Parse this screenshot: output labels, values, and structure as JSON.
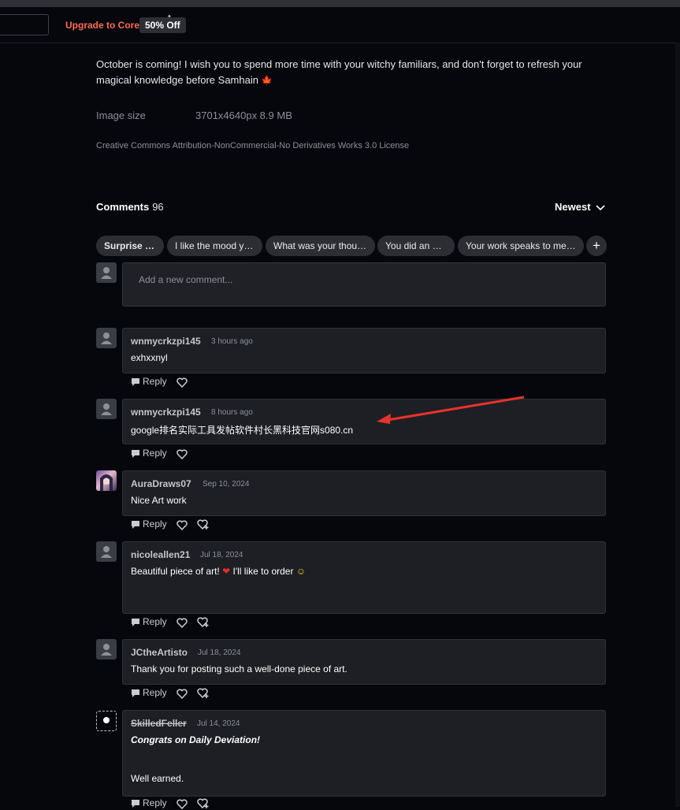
{
  "header": {
    "upgrade_link": "Upgrade to Core",
    "discount_badge": "50% Off"
  },
  "description": {
    "text": "October is coming! I wish you to spend more time with your witchy familiars, and don't forget to refresh your magical knowledge before Samhain",
    "icon": "maple-leaf-icon"
  },
  "image_meta": {
    "label": "Image size",
    "value": "3701x4640px 8.9 MB",
    "license": "Creative Commons Attribution-NonCommercial-No Derivatives Works 3.0 License"
  },
  "comments": {
    "title": "Comments",
    "count": "96",
    "sort_label": "Newest",
    "suggestions": [
      "Surprise Me!",
      "I like the mood y…",
      "What was your thou…",
      "You did an a…",
      "Your work speaks to me …"
    ],
    "new_comment_placeholder": "Add a new comment...",
    "reply_label": "Reply",
    "items": [
      {
        "user": "wnmycrkzpi145",
        "time": "3 hours ago",
        "lines": [
          "exhxxnyl"
        ]
      },
      {
        "user": "wnmycrkzpi145",
        "time": "8 hours ago",
        "lines": [
          "google排名实际工具发帖软件村长黑科技官网s080.cn"
        ]
      },
      {
        "user": "AuraDraws07",
        "time": "Sep 10, 2024",
        "lines": [
          "Nice Art work"
        ]
      },
      {
        "user": "nicoleallen21",
        "time": "Jul 18, 2024",
        "lines": [
          "Beautiful piece of art!",
          "I'll like to order"
        ]
      },
      {
        "user": "JCtheArtisto",
        "time": "Jul 18, 2024",
        "lines": [
          "Thank you for posting such a well-done piece of art."
        ]
      },
      {
        "user": "SkilledFeller",
        "time": "Jul 14, 2024",
        "lines": [
          "Congrats on Daily Deviation!",
          "Well earned."
        ]
      }
    ]
  },
  "colors": {
    "accent": "#ff6c4f",
    "background": "#06070d",
    "card": "#1d1f24",
    "annotation_arrow": "#e8322c"
  }
}
